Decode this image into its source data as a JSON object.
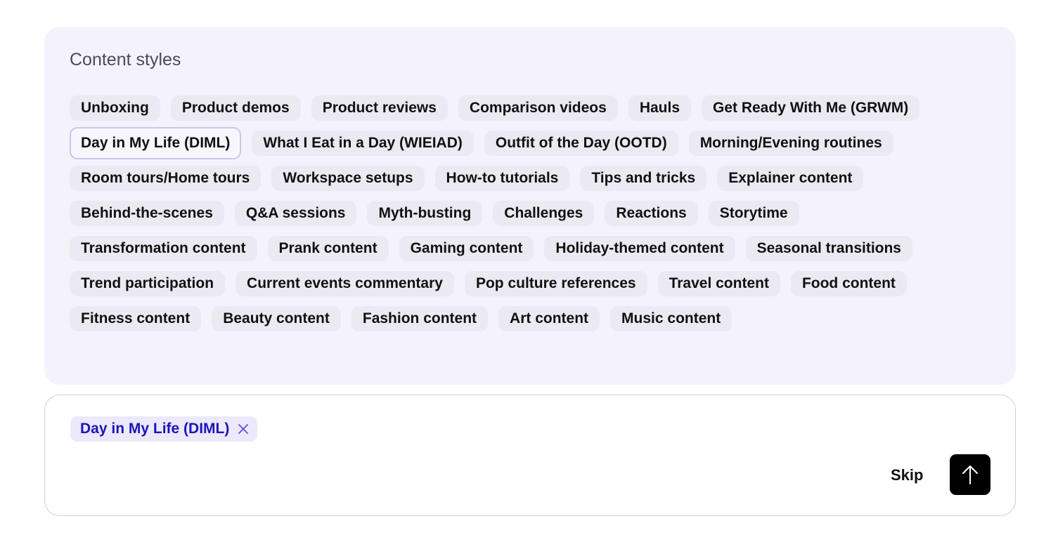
{
  "content_styles": {
    "title": "Content styles",
    "selected_index": 6,
    "options": [
      "Unboxing",
      "Product demos",
      "Product reviews",
      "Comparison videos",
      "Hauls",
      "Get Ready With Me (GRWM)",
      "Day in My Life (DIML)",
      "What I Eat in a Day (WIEIAD)",
      "Outfit of the Day (OOTD)",
      "Morning/Evening routines",
      "Room tours/Home tours",
      "Workspace setups",
      "How-to tutorials",
      "Tips and tricks",
      "Explainer content",
      "Behind-the-scenes",
      "Q&A sessions",
      "Myth-busting",
      "Challenges",
      "Reactions",
      "Storytime",
      "Transformation content",
      "Prank content",
      "Gaming content",
      "Holiday-themed content",
      "Seasonal transitions",
      "Trend participation",
      "Current events commentary",
      "Pop culture references",
      "Travel content",
      "Food content",
      "Fitness content",
      "Beauty content",
      "Fashion content",
      "Art content",
      "Music content"
    ]
  },
  "composer": {
    "selected_tag": "Day in My Life (DIML)",
    "remove_icon": "close-icon",
    "skip_label": "Skip",
    "send_icon": "arrow-up-icon"
  },
  "colors": {
    "panel_bg": "#f4f3fc",
    "chip_bg": "#ebeaf2",
    "selected_border": "#c9c5f0",
    "tag_bg": "#ebe9fb",
    "tag_text": "#1f14b8",
    "send_bg": "#000000"
  }
}
